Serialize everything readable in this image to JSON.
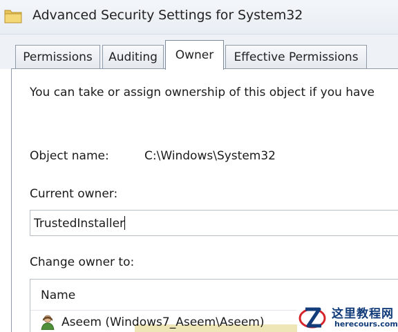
{
  "window": {
    "title": "Advanced Security Settings for System32",
    "icon": "folder-icon"
  },
  "tabs": [
    {
      "label": "Permissions",
      "selected": false
    },
    {
      "label": "Auditing",
      "selected": false
    },
    {
      "label": "Owner",
      "selected": true
    },
    {
      "label": "Effective Permissions",
      "selected": false
    }
  ],
  "owner_tab": {
    "info_text": "You can take or assign ownership of this object if you have",
    "object_name_label": "Object name:",
    "object_name_value": "C:\\Windows\\System32",
    "current_owner_label": "Current owner:",
    "current_owner_value": "TrustedInstaller",
    "change_owner_label": "Change owner to:",
    "list": {
      "columns": [
        "Name"
      ],
      "rows": [
        {
          "name": "Aseem (Windows7_Aseem\\Aseem)",
          "icon": "user-icon"
        }
      ]
    }
  },
  "watermark": {
    "text_cn": "这里教程网",
    "text_en": "herecours.com"
  },
  "colors": {
    "title_bar": "#e9eef4",
    "tab_border": "#8e9aa8",
    "watermark_blue": "#123c7a",
    "watermark_red": "#d6242a"
  }
}
